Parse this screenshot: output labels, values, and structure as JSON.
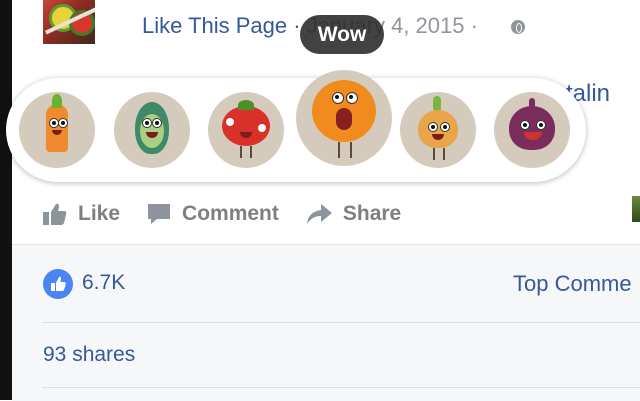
{
  "post": {
    "like_page_label": "Like This Page",
    "separator": " · ",
    "date": "January 4, 2015",
    "date_dot": " · ",
    "author_peek": "talin"
  },
  "tooltip": {
    "label": "Wow"
  },
  "reactions": [
    {
      "icon": "carrot-character-icon"
    },
    {
      "icon": "avocado-character-icon"
    },
    {
      "icon": "tomato-character-icon"
    },
    {
      "icon": "orange-character-wow-icon"
    },
    {
      "icon": "onion-character-icon"
    },
    {
      "icon": "fig-character-icon"
    }
  ],
  "actions": {
    "like": "Like",
    "comment": "Comment",
    "share": "Share"
  },
  "stats": {
    "like_count": "6.7K",
    "top_comments": "Top Comme",
    "shares": "93 shares"
  },
  "colors": {
    "link_blue": "#365899",
    "muted_gray": "#7f7f7f",
    "like_blue": "#4a85f3"
  }
}
